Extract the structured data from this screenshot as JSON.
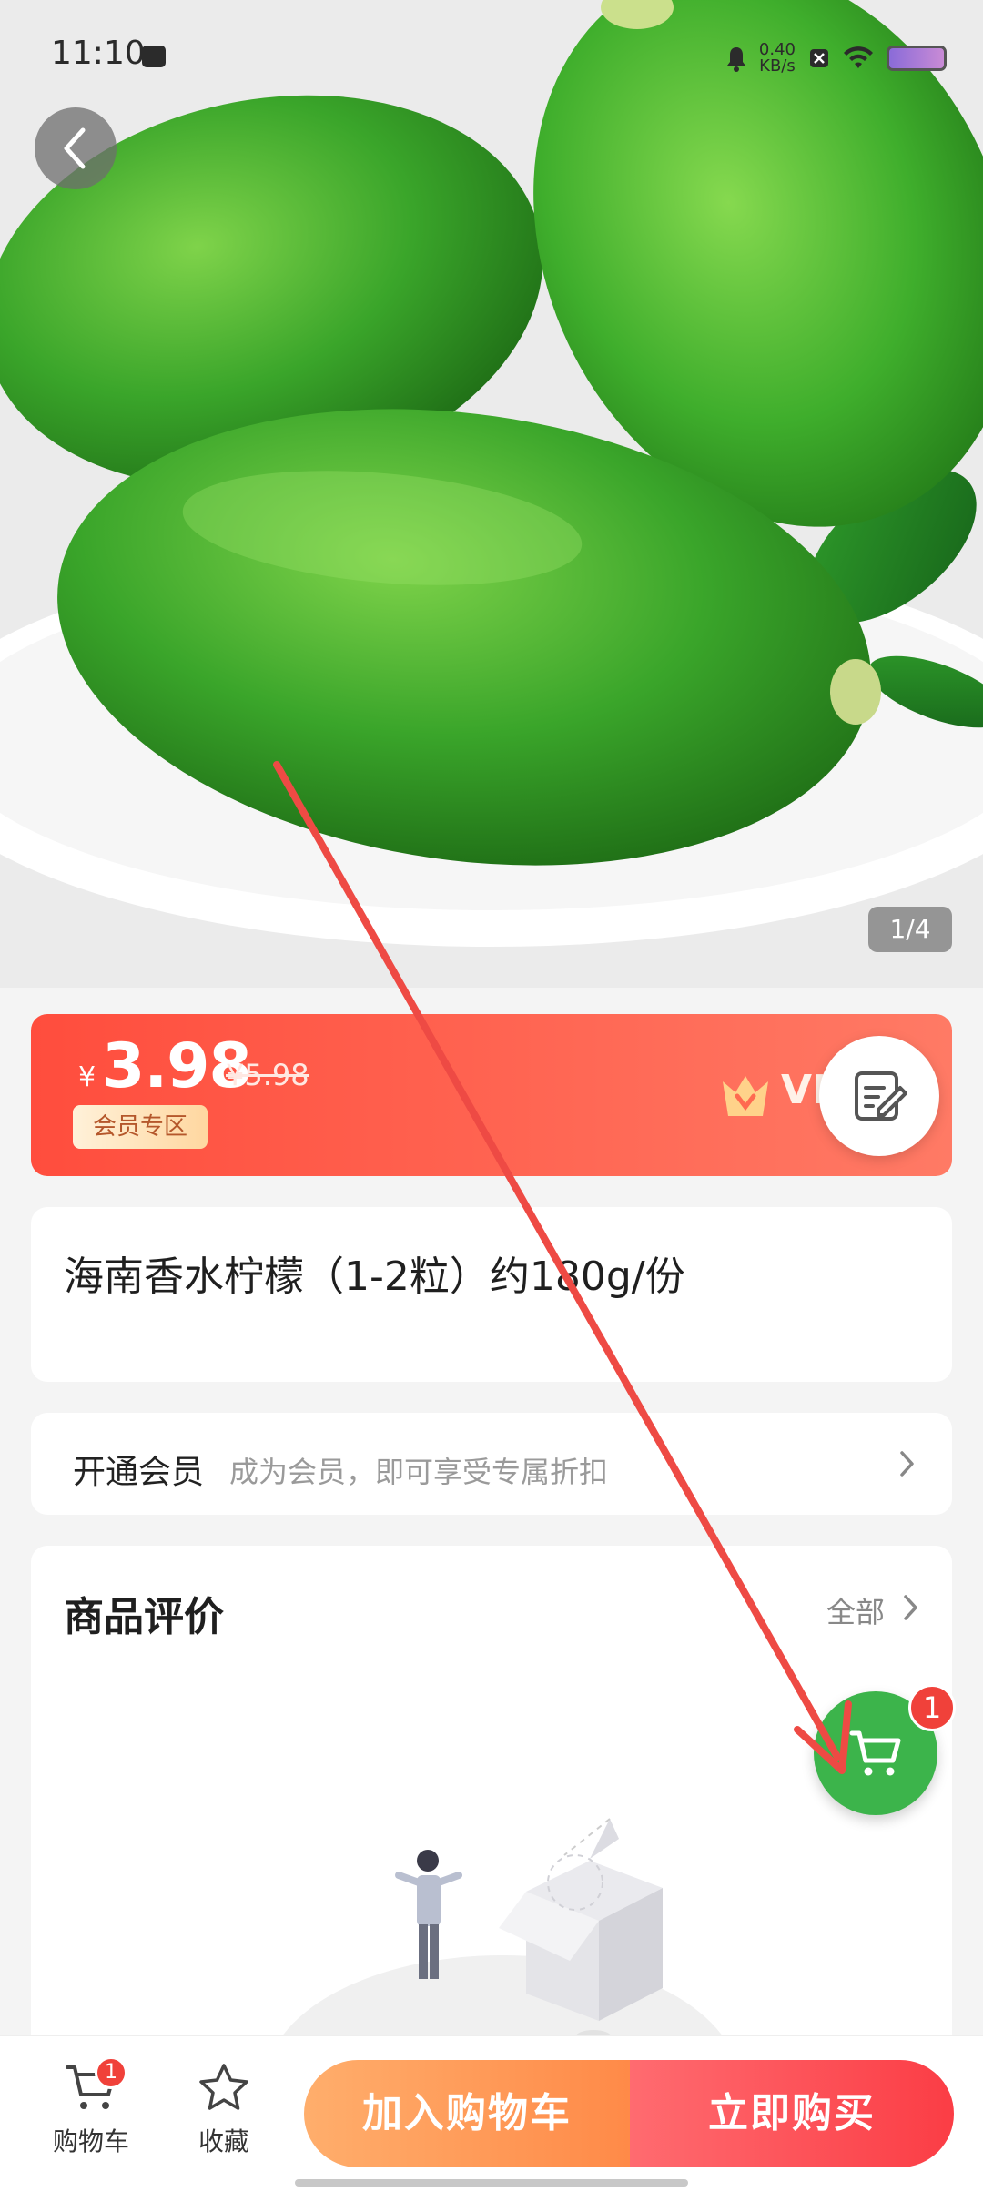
{
  "status_bar": {
    "time": "11:10",
    "net_speed_value": "0.40",
    "net_speed_unit": "KB/s"
  },
  "gallery": {
    "counter": "1/4"
  },
  "price": {
    "currency": "¥",
    "current": "3.98",
    "original": "¥5.98",
    "member_tag": "会员专区",
    "vip_label": "VI"
  },
  "product": {
    "title": "海南香水柠檬（1-2粒）约180g/份"
  },
  "membership": {
    "title": "开通会员",
    "description": "成为会员，即可享受专属折扣"
  },
  "reviews": {
    "title": "商品评价",
    "all_label": "全部"
  },
  "floating_cart": {
    "badge": "1"
  },
  "bottom_bar": {
    "cart_label": "购物车",
    "cart_badge": "1",
    "favorite_label": "收藏",
    "add_to_cart": "加入购物车",
    "buy_now": "立即购买"
  },
  "colors": {
    "price_banner": "#ff5a48",
    "accent_green": "#3cb44b",
    "badge_red": "#f0413a",
    "annotation_arrow": "#ee4a44"
  }
}
